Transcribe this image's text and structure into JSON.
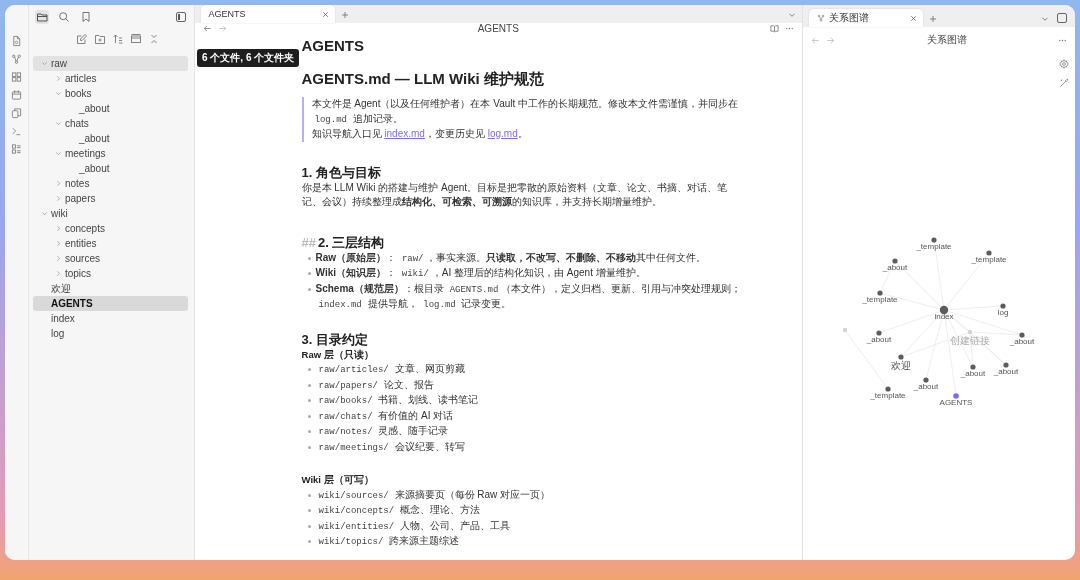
{
  "sidebar": {
    "tree": [
      {
        "label": "raw",
        "kind": "folder",
        "expanded": true,
        "selected": false,
        "hovered": true,
        "children": [
          {
            "label": "articles",
            "kind": "folder",
            "expanded": false,
            "selected": false,
            "hovered": false
          },
          {
            "label": "books",
            "kind": "folder",
            "expanded": true,
            "selected": false,
            "hovered": false,
            "children": [
              {
                "label": "_about",
                "kind": "file",
                "selected": false,
                "hovered": false
              }
            ]
          },
          {
            "label": "chats",
            "kind": "folder",
            "expanded": true,
            "selected": false,
            "hovered": false,
            "children": [
              {
                "label": "_about",
                "kind": "file",
                "selected": false,
                "hovered": false
              }
            ]
          },
          {
            "label": "meetings",
            "kind": "folder",
            "expanded": true,
            "selected": false,
            "hovered": false,
            "children": [
              {
                "label": "_about",
                "kind": "file",
                "selected": false,
                "hovered": false
              }
            ]
          },
          {
            "label": "notes",
            "kind": "folder",
            "expanded": false,
            "selected": false,
            "hovered": false
          },
          {
            "label": "papers",
            "kind": "folder",
            "expanded": false,
            "selected": false,
            "hovered": false
          }
        ]
      },
      {
        "label": "wiki",
        "kind": "folder",
        "expanded": true,
        "selected": false,
        "hovered": false,
        "children": [
          {
            "label": "concepts",
            "kind": "folder",
            "expanded": false,
            "selected": false,
            "hovered": false
          },
          {
            "label": "entities",
            "kind": "folder",
            "expanded": false,
            "selected": false,
            "hovered": false
          },
          {
            "label": "sources",
            "kind": "folder",
            "expanded": false,
            "selected": false,
            "hovered": false
          },
          {
            "label": "topics",
            "kind": "folder",
            "expanded": false,
            "selected": false,
            "hovered": false
          }
        ]
      },
      {
        "label": "欢迎",
        "kind": "file",
        "selected": false,
        "hovered": false
      },
      {
        "label": "AGENTS",
        "kind": "file",
        "selected": true,
        "hovered": false
      },
      {
        "label": "index",
        "kind": "file",
        "selected": false,
        "hovered": false
      },
      {
        "label": "log",
        "kind": "file",
        "selected": false,
        "hovered": false
      }
    ]
  },
  "tooltip": "6 个文件, 6 个文件夹",
  "editor": {
    "tabs": [
      {
        "label": "AGENTS",
        "selected": true
      }
    ],
    "header_title": "AGENTS",
    "document": [
      {
        "kind": "title",
        "text": "AGENTS"
      },
      {
        "kind": "h1",
        "text": "AGENTS.md — LLM Wiki 维护规范"
      },
      {
        "kind": "quote",
        "paragraphs": [
          [
            {
              "kind": "text",
              "text": "本文件是 Agent（以及任何维护者）在本 Vault 中工作的长期规范。修改本文件需谨慎，并同步在 "
            },
            {
              "kind": "code",
              "text": "log.md"
            },
            {
              "kind": "text",
              "text": " 追加记录。"
            }
          ],
          [
            {
              "kind": "text",
              "text": "知识导航入口见 "
            },
            {
              "kind": "link",
              "text": "index.md"
            },
            {
              "kind": "text",
              "text": "，变更历史见 "
            },
            {
              "kind": "link",
              "text": "log.md"
            },
            {
              "kind": "text",
              "text": "。"
            }
          ]
        ]
      },
      {
        "kind": "h2",
        "text": "1. 角色与目标"
      },
      {
        "kind": "para",
        "segments": [
          {
            "kind": "text",
            "text": "你是本 LLM Wiki 的搭建与维护 Agent。目标是把零散的原始资料（文章、论文、书摘、对话、笔记、会议）持续整理成**结构化、可检索、可溯源**的知识库，并支持长期增量维护。"
          }
        ]
      },
      {
        "kind": "h2",
        "marker": "##",
        "text": "2. 三层结构"
      },
      {
        "kind": "list",
        "items": [
          [
            {
              "kind": "text",
              "text": "**Raw（原始层）**： "
            },
            {
              "kind": "code",
              "text": "raw/"
            },
            {
              "kind": "text",
              "text": "，事实来源。**只读取，不改写、不删除、不移动**其中任何文件。"
            }
          ],
          [
            {
              "kind": "text",
              "text": "**Wiki（知识层）**： "
            },
            {
              "kind": "code",
              "text": "wiki/"
            },
            {
              "kind": "text",
              "text": "，AI 整理后的结构化知识，由 Agent 增量维护。"
            }
          ],
          [
            {
              "kind": "text",
              "text": "**Schema（规范层）**：根目录 "
            },
            {
              "kind": "code",
              "text": "AGENTS.md"
            },
            {
              "kind": "text",
              "text": "（本文件），定义归档、更新、引用与冲突处理规则； "
            },
            {
              "kind": "code",
              "text": "index.md"
            },
            {
              "kind": "text",
              "text": " 提供导航， "
            },
            {
              "kind": "code",
              "text": "log.md"
            },
            {
              "kind": "text",
              "text": " 记录变更。"
            }
          ]
        ]
      },
      {
        "kind": "h2",
        "text": "3. 目录约定"
      },
      {
        "kind": "h3",
        "text": "Raw 层（只读）"
      },
      {
        "kind": "list",
        "items": [
          [
            {
              "kind": "code",
              "text": "raw/articles/"
            },
            {
              "kind": "text",
              "text": " 文章、网页剪藏"
            }
          ],
          [
            {
              "kind": "code",
              "text": "raw/papers/"
            },
            {
              "kind": "text",
              "text": " 论文、报告"
            }
          ],
          [
            {
              "kind": "code",
              "text": "raw/books/"
            },
            {
              "kind": "text",
              "text": " 书籍、划线、读书笔记"
            }
          ],
          [
            {
              "kind": "code",
              "text": "raw/chats/"
            },
            {
              "kind": "text",
              "text": " 有价值的 AI 对话"
            }
          ],
          [
            {
              "kind": "code",
              "text": "raw/notes/"
            },
            {
              "kind": "text",
              "text": " 灵感、随手记录"
            }
          ],
          [
            {
              "kind": "code",
              "text": "raw/meetings/"
            },
            {
              "kind": "text",
              "text": " 会议纪要、转写"
            }
          ]
        ]
      },
      {
        "kind": "h3",
        "text": "Wiki 层（可写）"
      },
      {
        "kind": "list",
        "items": [
          [
            {
              "kind": "code",
              "text": "wiki/sources/"
            },
            {
              "kind": "text",
              "text": " 来源摘要页（每份 Raw 对应一页）"
            }
          ],
          [
            {
              "kind": "code",
              "text": "wiki/concepts/"
            },
            {
              "kind": "text",
              "text": " 概念、理论、方法"
            }
          ],
          [
            {
              "kind": "code",
              "text": "wiki/entities/"
            },
            {
              "kind": "text",
              "text": " 人物、公司、产品、工具"
            }
          ],
          [
            {
              "kind": "code",
              "text": "wiki/topics/"
            },
            {
              "kind": "text",
              "text": " 跨来源主题综述"
            }
          ]
        ]
      }
    ]
  },
  "graph": {
    "tabs": [
      {
        "label": "关系图谱",
        "selected": true
      }
    ],
    "header_title": "关系图谱",
    "nodes": [
      {
        "label": "_template",
        "kind": "note"
      },
      {
        "label": "_template",
        "kind": "note"
      },
      {
        "label": "_about",
        "kind": "note"
      },
      {
        "label": "_template",
        "kind": "note"
      },
      {
        "label": "index",
        "kind": "hub"
      },
      {
        "label": "log",
        "kind": "note"
      },
      {
        "kind": "unresolved"
      },
      {
        "label": "_about",
        "kind": "note"
      },
      {
        "label": "创建链接",
        "kind": "unresolved"
      },
      {
        "label": "_about",
        "kind": "note"
      },
      {
        "label": "欢迎",
        "kind": "note"
      },
      {
        "label": "_about",
        "kind": "note"
      },
      {
        "label": "_about",
        "kind": "note"
      },
      {
        "label": "_about",
        "kind": "note"
      },
      {
        "label": "_template",
        "kind": "note"
      },
      {
        "label": "AGENTS",
        "kind": "current"
      }
    ]
  }
}
